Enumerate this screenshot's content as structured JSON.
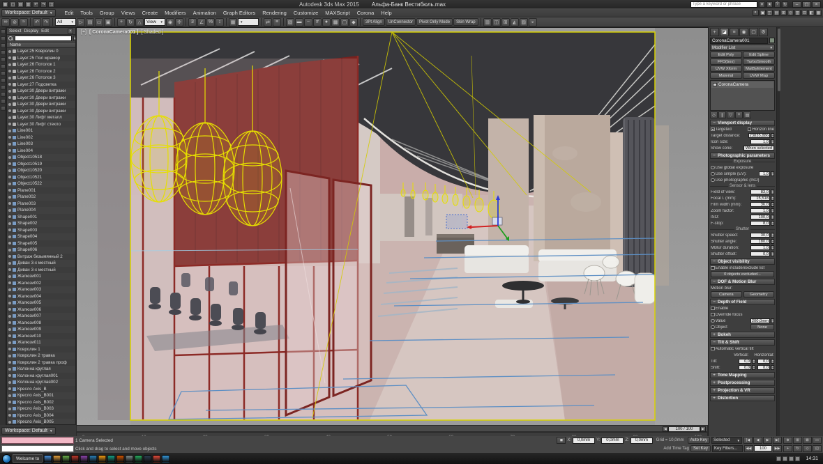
{
  "ui": {
    "collapse_glyph": "−",
    "expand_glyph": "+",
    "caret": "▼"
  },
  "colors": {
    "accent_yellow": "#e6df00",
    "wall_red": "#78211e",
    "maxscript_pink": "#f2b8c6",
    "floor_pink": "#c9adaa",
    "ceiling_gray": "#37373b",
    "spline_blue": "#5d8fc4"
  },
  "titlebar": {
    "app_title": "Autodesk 3ds Max 2015",
    "doc_title": "Альфа-Банк Вестибюль.max",
    "search_placeholder": "Type a keyword or phrase",
    "qat_icons": [
      {
        "name": "application-menu",
        "g": "▦"
      },
      {
        "name": "new-scene",
        "g": "▢"
      },
      {
        "name": "open-file",
        "g": "▤"
      },
      {
        "name": "save-file",
        "g": "▥"
      },
      {
        "name": "undo-qat",
        "g": "↶"
      },
      {
        "name": "redo-qat",
        "g": "↷"
      },
      {
        "name": "project-folder",
        "g": "◫"
      }
    ],
    "right_icons": [
      {
        "name": "sign-in",
        "g": "▾"
      },
      {
        "name": "favorites",
        "g": "★"
      },
      {
        "name": "help",
        "g": "?"
      },
      {
        "name": "communication-center",
        "g": "↻"
      }
    ],
    "window_buttons": [
      {
        "name": "minimize-window",
        "g": "–"
      },
      {
        "name": "maximize-window",
        "g": "▢"
      },
      {
        "name": "close-window",
        "g": "×"
      }
    ]
  },
  "menubar": {
    "workspace": "Workspace: Default",
    "items": [
      "Edit",
      "Tools",
      "Group",
      "Views",
      "Create",
      "Modifiers",
      "Animation",
      "Graph Editors",
      "Rendering",
      "Customize",
      "MAXScript",
      "Corona",
      "Help"
    ],
    "right_icons": [
      {
        "name": "menu-toolbar-1",
        "g": "◐"
      },
      {
        "name": "menu-toolbar-2",
        "g": "▣"
      },
      {
        "name": "menu-toolbar-3",
        "g": "◫"
      },
      {
        "name": "menu-toolbar-4",
        "g": "▤"
      },
      {
        "name": "menu-toolbar-5",
        "g": "⊞"
      },
      {
        "name": "menu-toolbar-6",
        "g": "◎"
      },
      {
        "name": "menu-toolbar-7",
        "g": "▥"
      },
      {
        "name": "menu-toolbar-8",
        "g": "⊟"
      },
      {
        "name": "menu-toolbar-9",
        "g": "◧"
      },
      {
        "name": "menu-toolbar-10",
        "g": "▦"
      }
    ]
  },
  "toolbar": {
    "items": [
      {
        "t": "icon",
        "name": "select-and-link",
        "g": "∞"
      },
      {
        "t": "icon",
        "name": "unlink-selection",
        "g": "⊘"
      },
      {
        "t": "icon",
        "name": "bind-to-space-warp",
        "g": "≈"
      },
      {
        "t": "sep"
      },
      {
        "t": "icon",
        "name": "undo",
        "g": "↶"
      },
      {
        "t": "icon",
        "name": "redo",
        "g": "↷"
      },
      {
        "t": "sep"
      },
      {
        "t": "select",
        "name": "selection-filter",
        "value": "All"
      },
      {
        "t": "icon",
        "name": "select-object",
        "g": "▷"
      },
      {
        "t": "icon",
        "name": "select-by-name",
        "g": "▤"
      },
      {
        "t": "icon",
        "name": "rectangular-selection-region",
        "g": "▭"
      },
      {
        "t": "icon",
        "name": "window-crossing",
        "g": "▣"
      },
      {
        "t": "sep"
      },
      {
        "t": "icon",
        "name": "select-and-move",
        "g": "+"
      },
      {
        "t": "icon",
        "name": "select-and-rotate",
        "g": "↻"
      },
      {
        "t": "icon",
        "name": "select-and-scale",
        "g": "△"
      },
      {
        "t": "select",
        "name": "reference-coordinate-system",
        "value": "View"
      },
      {
        "t": "icon",
        "name": "use-pivot-point-center",
        "g": "◉"
      },
      {
        "t": "icon",
        "name": "select-and-manipulate",
        "g": "✢"
      },
      {
        "t": "sep"
      },
      {
        "t": "icon",
        "name": "snaps-toggle-3d",
        "g": "3"
      },
      {
        "t": "icon",
        "name": "angle-snap-toggle",
        "g": "∠"
      },
      {
        "t": "icon",
        "name": "percent-snap-toggle",
        "g": "%"
      },
      {
        "t": "icon",
        "name": "spinner-snap-toggle",
        "g": "↕"
      },
      {
        "t": "sep"
      },
      {
        "t": "icon",
        "name": "edit-named-selection-sets",
        "g": "▦"
      },
      {
        "t": "select",
        "name": "named-selection-sets",
        "value": ""
      },
      {
        "t": "sep"
      },
      {
        "t": "icon",
        "name": "mirror",
        "g": "⇄"
      },
      {
        "t": "icon",
        "name": "align",
        "g": "≡"
      },
      {
        "t": "sep"
      },
      {
        "t": "icon",
        "name": "layer-manager",
        "g": "▧"
      },
      {
        "t": "icon",
        "name": "graphite-ribbon-toggle",
        "g": "▬"
      },
      {
        "t": "icon",
        "name": "curve-editor",
        "g": "~"
      },
      {
        "t": "icon",
        "name": "schematic-view",
        "g": "#"
      },
      {
        "t": "icon",
        "name": "material-editor",
        "g": "●"
      },
      {
        "t": "icon",
        "name": "render-setup",
        "g": "▩"
      },
      {
        "t": "icon",
        "name": "rendered-frame-window",
        "g": "▢"
      },
      {
        "t": "icon",
        "name": "render-production",
        "g": "◆"
      },
      {
        "t": "sep"
      },
      {
        "t": "btn",
        "name": "3pt-align",
        "label": "3Pt Align"
      },
      {
        "t": "btn",
        "name": "unconnector",
        "label": "UnConnector"
      },
      {
        "t": "btn",
        "name": "pivot-only-mode",
        "label": "Pivot Only Mode"
      },
      {
        "t": "btn",
        "name": "skin-wrap",
        "label": "Skin Wrap"
      },
      {
        "t": "sep"
      },
      {
        "t": "icon",
        "name": "toolbar-extra-1",
        "g": "▥"
      },
      {
        "t": "icon",
        "name": "toolbar-extra-2",
        "g": "◫"
      },
      {
        "t": "icon",
        "name": "toolbar-extra-3",
        "g": "⊞"
      },
      {
        "t": "icon",
        "name": "toolbar-extra-4",
        "g": "◭"
      },
      {
        "t": "icon",
        "name": "toolbar-extra-5",
        "g": "▨"
      },
      {
        "t": "icon",
        "name": "toolbar-extra-6",
        "g": "◒"
      }
    ]
  },
  "left_strip": {
    "icons": [
      "▭",
      "◧",
      "▤",
      "⊞",
      "◫",
      "▦",
      "◨",
      "▥",
      "⊟",
      "◩",
      "▣",
      "◪"
    ]
  },
  "scene_explorer": {
    "menus": [
      "Select",
      "Display",
      "Edit"
    ],
    "name_header": "Name",
    "items": [
      "Layer:25 Ковролин 0",
      "Layer:25 Пол мрамор",
      "Layer:26 Потолок 1",
      "Layer:26 Потолок 2",
      "Layer:26 Потолок 3",
      "Layer:27 Подсветка",
      "Layer:30 Двери витражи",
      "Layer:30 Двери витражи",
      "Layer:30 Двери витражи",
      "Layer:30 Двери витражи",
      "Layer:30 Лифт металл",
      "Layer:30 Лифт стекло",
      "Line001",
      "Line002",
      "Line003",
      "Line004",
      "Object10518",
      "Object10519",
      "Object10520",
      "Object10521",
      "Object10522",
      "Plane001",
      "Plane002",
      "Plane003",
      "Plane004",
      "Shape001",
      "Shape002",
      "Shape003",
      "Shape004",
      "Shape005",
      "Shape006",
      "Витраж безымянный 2",
      "Диван 3-х местный",
      "Диван 3-х местный",
      "Жалюзи001",
      "Жалюзи002",
      "Жалюзи003",
      "Жалюзи004",
      "Жалюзи005",
      "Жалюзи006",
      "Жалюзи007",
      "Жалюзи008",
      "Жалюзи009",
      "Жалюзи010",
      "Жалюзи011",
      "Ковролин 1",
      "Ковролин 2 травка",
      "Ковролин 2 травка проф",
      "Колонна круглая",
      "Колонна круглая001",
      "Колонна круглая002",
      "Кресло Axis_B",
      "Кресло Axis_B001",
      "Кресло Axis_B002",
      "Кресло Axis_B003",
      "Кресло Axis_B004",
      "Кресло Axis_B005"
    ]
  },
  "viewport": {
    "label_plus": "[+]",
    "label_camera": "[ CoronaCamera001 ]",
    "label_shading": "[ Shaded ]"
  },
  "timeline": {
    "slider_value": "100 / 100",
    "ticks": [
      "0",
      "10",
      "20",
      "30",
      "40",
      "50",
      "60",
      "70",
      "80",
      "90",
      "100"
    ]
  },
  "command_panel": {
    "tabs": [
      {
        "name": "create-tab",
        "g": "+"
      },
      {
        "name": "modify-tab",
        "g": "◪"
      },
      {
        "name": "hierarchy-tab",
        "g": "≡"
      },
      {
        "name": "motion-tab",
        "g": "◉"
      },
      {
        "name": "display-tab",
        "g": "▢"
      },
      {
        "name": "utilities-tab",
        "g": "⚙"
      }
    ],
    "object_name": "CoronaCamera001",
    "modifier_list": "Modifier List",
    "modifier_buttons": [
      "Edit Poly",
      "Edit Spline",
      "FFD(box)",
      "TurboSmooth",
      "UVW Xform",
      "MatByElement",
      "Material",
      "UVW Map"
    ],
    "stack": [
      "CoronaCamera"
    ],
    "stack_tools": [
      {
        "name": "pin-stack",
        "g": "◇"
      },
      {
        "name": "show-end-result",
        "g": "∥"
      },
      {
        "name": "make-unique",
        "g": "▽"
      },
      {
        "name": "remove-modifier",
        "g": "×"
      },
      {
        "name": "configure-modifier-sets",
        "g": "▤"
      }
    ],
    "vd": {
      "title": "Viewport display",
      "targeted": "Targeted",
      "horizon": "Horizon line",
      "target_distance_label": "Target distance:",
      "target_distance": "23835,886",
      "icon_size_label": "Icon size:",
      "icon_size": "1,0",
      "show_cone_label": "Show cone:",
      "show_cone_value": "When selected"
    },
    "ph": {
      "title": "Photographic parameters",
      "exposure": "Exposure",
      "use_global": "Use global exposure",
      "use_simple": "Use simple (EV):",
      "ev": "1,0",
      "use_photo": "Use photographic (ISO)",
      "sensor": "Sensor & lens",
      "sensor_rows": [
        {
          "label": "Field of view:",
          "value": "83,0"
        },
        {
          "label": "Focal l. (mm):",
          "value": "15,518"
        },
        {
          "label": "Film width (mm):",
          "value": "36,0"
        },
        {
          "label": "Zoom factor:",
          "value": "1,0"
        },
        {
          "label": "ISO:",
          "value": "100,0"
        },
        {
          "label": "F-stop:",
          "value": "8,0"
        }
      ],
      "shutter": "Shutter",
      "shutter_rows": [
        {
          "label": "Shutter speed:",
          "value": "30,0"
        },
        {
          "label": "Shutter angle:",
          "value": "180,0"
        },
        {
          "label": "MBlur duration:",
          "value": "1,0"
        },
        {
          "label": "Shutter offset:",
          "value": "0,0"
        }
      ]
    },
    "ov": {
      "title": "Object visibility",
      "enable": "Enable include/exclude list",
      "excluded": "0 objects excluded..."
    },
    "dm": {
      "title": "DOF & Motion Blur",
      "mb_label": "Motion blur:",
      "camera": "Camera",
      "geometry": "Geometry"
    },
    "dof": {
      "title": "Depth of Field",
      "enable": "Enable",
      "override": "Override focus",
      "value_label": "Value",
      "value": "200,0mm",
      "object_label": "Object",
      "object_value": "None"
    },
    "collapsed_mid": [
      "Bokeh"
    ],
    "ts": {
      "title": "Tilt & Shift",
      "auto": "Automatic vertical tilt",
      "vertical": "Vertical:",
      "horizontal": "Horizontal:",
      "tilt": "Tilt:",
      "tilt_v": "0,0",
      "tilt_h": "0,0",
      "shift": "Shift:",
      "shift_v": "0,0",
      "shift_h": "0,0"
    },
    "collapsed_bottom": [
      "Tone Mapping",
      "Postprocessing",
      "Projection & VR",
      "Distortion"
    ]
  },
  "status": {
    "selection_info": "1 Camera Selected",
    "prompt": "Click and drag to select and move objects",
    "coord_x_label": "X:",
    "coord_x": "0,0mm",
    "coord_y_label": "Y:",
    "coord_y": "0,0mm",
    "coord_z_label": "Z:",
    "coord_z": "0,0mm",
    "grid_info": "Grid = 10,0mm",
    "add_time_tag": "Add Time Tag",
    "auto_key": "Auto Key",
    "set_key": "Set Key",
    "key_mode": "Selected",
    "key_filters": "Key Filters...",
    "frame_field": "100",
    "workspace": "Workspace: Default"
  },
  "transport": {
    "row1": [
      {
        "name": "go-to-start",
        "g": "|◀"
      },
      {
        "name": "previous-frame",
        "g": "◀"
      },
      {
        "name": "play-animation",
        "g": "▶"
      },
      {
        "name": "go-to-end",
        "g": "▶|"
      }
    ],
    "row2_prev": {
      "name": "previous-key",
      "g": "◀◀"
    },
    "row2_next": {
      "name": "next-key",
      "g": "▶▶"
    }
  },
  "nav_icons": {
    "row1": [
      {
        "name": "zoom",
        "g": "⊕"
      },
      {
        "name": "zoom-all",
        "g": "⊞"
      },
      {
        "name": "zoom-extents",
        "g": "⊠"
      },
      {
        "name": "zoom-region",
        "g": "▭"
      }
    ],
    "row2": [
      {
        "name": "pan-view",
        "g": "+"
      },
      {
        "name": "orbit",
        "g": "↻"
      },
      {
        "name": "field-of-view",
        "g": "◇"
      },
      {
        "name": "maximize-viewport-toggle",
        "g": "◱"
      }
    ]
  },
  "taskbar": {
    "welcome_item": "Welcome to",
    "clock": "14:31",
    "app_icon_colors": [
      "#4a90d9",
      "#e8a33d",
      "#6ab04c",
      "#c0392b",
      "#8e44ad",
      "#2980b9",
      "#f39c12",
      "#16a085",
      "#d35400",
      "#7f8c8d",
      "#27ae60",
      "#2c3e50",
      "#e74c3c",
      "#3498db"
    ],
    "tray_count": 4
  }
}
